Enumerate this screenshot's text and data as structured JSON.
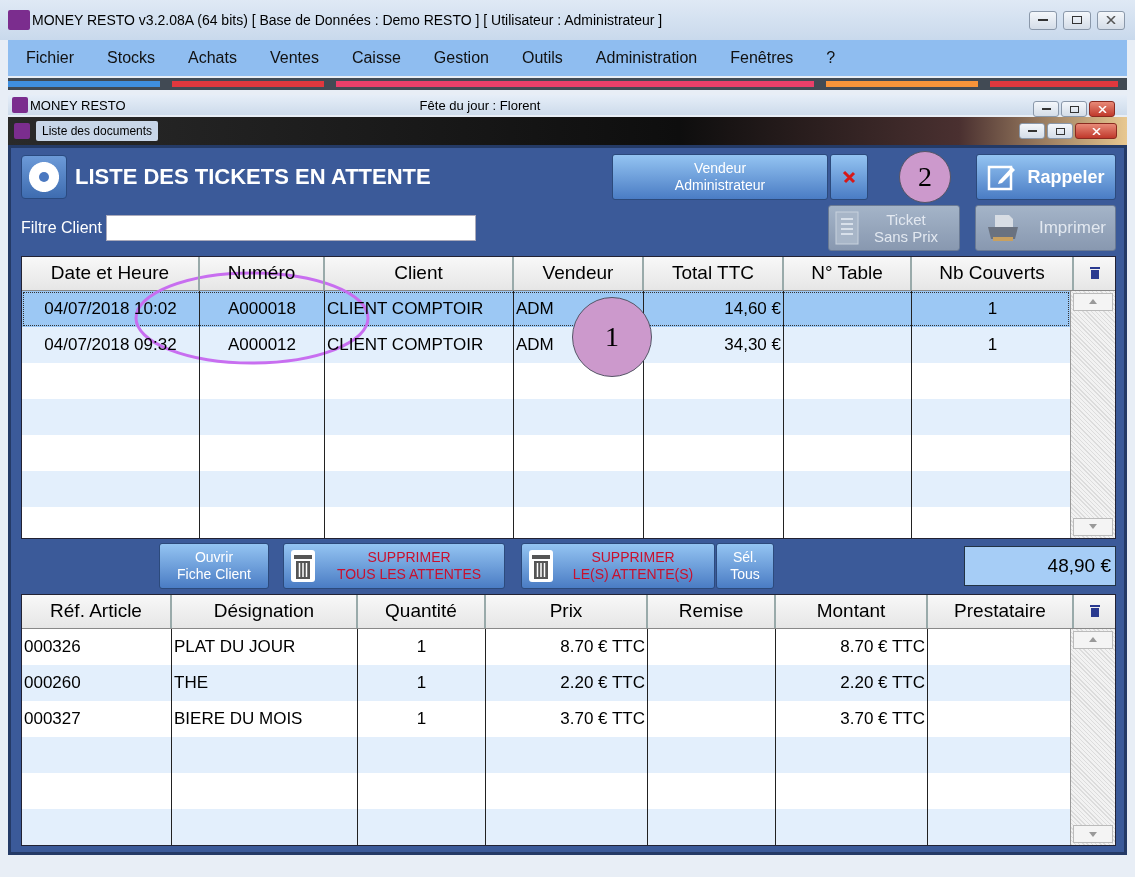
{
  "window": {
    "title": "MONEY RESTO v3.2.08A (64 bits) [ Base de Données : Demo RESTO ] [ Utilisateur : Administrateur ]"
  },
  "menu": [
    "Fichier",
    "Stocks",
    "Achats",
    "Ventes",
    "Caisse",
    "Gestion",
    "Outils",
    "Administration",
    "Fenêtres",
    "?"
  ],
  "color_strip": [
    {
      "color": "#3f8fe0"
    },
    {
      "color": "#e0383e"
    },
    {
      "color": "#e8406a"
    },
    {
      "color": "#f7943a"
    },
    {
      "color": "#e0383e"
    }
  ],
  "inner_window": {
    "title": "MONEY RESTO",
    "center_text": "Fête du jour  : Florent"
  },
  "dialog": {
    "title": "Liste des documents"
  },
  "panel": {
    "heading": "LISTE DES TICKETS EN ATTENTE",
    "vendor_button": [
      "Vendeur",
      "Administrateur"
    ],
    "recall_button": "Rappeler",
    "ticket_button": {
      "lines": [
        "Ticket",
        "Sans Prix"
      ],
      "disabled": true
    },
    "print_button": {
      "label": "Imprimer",
      "disabled": true
    },
    "filter": {
      "label": "Filtre Client"
    }
  },
  "tickets": {
    "columns": [
      "Date et Heure",
      "Numéro",
      "Client",
      "Vendeur",
      "Total TTC",
      "N° Table",
      "Nb Couverts"
    ],
    "rows": [
      {
        "cells": [
          "04/07/2018 10:02",
          "A000018",
          "CLIENT COMPTOIR",
          "ADM",
          "14,60 €",
          "",
          "1"
        ],
        "selected": true
      },
      {
        "cells": [
          "04/07/2018 09:32",
          "A000012",
          "CLIENT COMPTOIR",
          "ADM",
          "34,30 €",
          "",
          "1"
        ],
        "selected": false
      }
    ]
  },
  "actions": [
    {
      "kind": "plain",
      "lines": [
        "Ouvrir",
        "Fiche Client"
      ]
    },
    {
      "kind": "delete",
      "lines": [
        "SUPPRIMER",
        "TOUS LES ATTENTES"
      ]
    },
    {
      "kind": "delete",
      "lines": [
        "SUPPRIMER",
        "LE(S) ATTENTE(S)"
      ]
    },
    {
      "kind": "plain",
      "lines": [
        "Sél.",
        "Tous"
      ]
    }
  ],
  "total": "48,90 €",
  "lines": {
    "columns": [
      "Réf. Article",
      "Désignation",
      "Quantité",
      "Prix",
      "Remise",
      "Montant",
      "Prestataire"
    ],
    "rows": [
      {
        "cells": [
          "000326",
          "PLAT DU JOUR",
          "1",
          "8.70 € TTC",
          "",
          "8.70 € TTC",
          ""
        ]
      },
      {
        "cells": [
          "000260",
          "THE",
          "1",
          "2.20 € TTC",
          "",
          "2.20 € TTC",
          ""
        ]
      },
      {
        "cells": [
          "000327",
          "BIERE DU MOIS",
          "1",
          "3.70 € TTC",
          "",
          "3.70 € TTC",
          ""
        ]
      }
    ]
  },
  "annotations": [
    {
      "label": "1"
    },
    {
      "label": "2"
    }
  ]
}
